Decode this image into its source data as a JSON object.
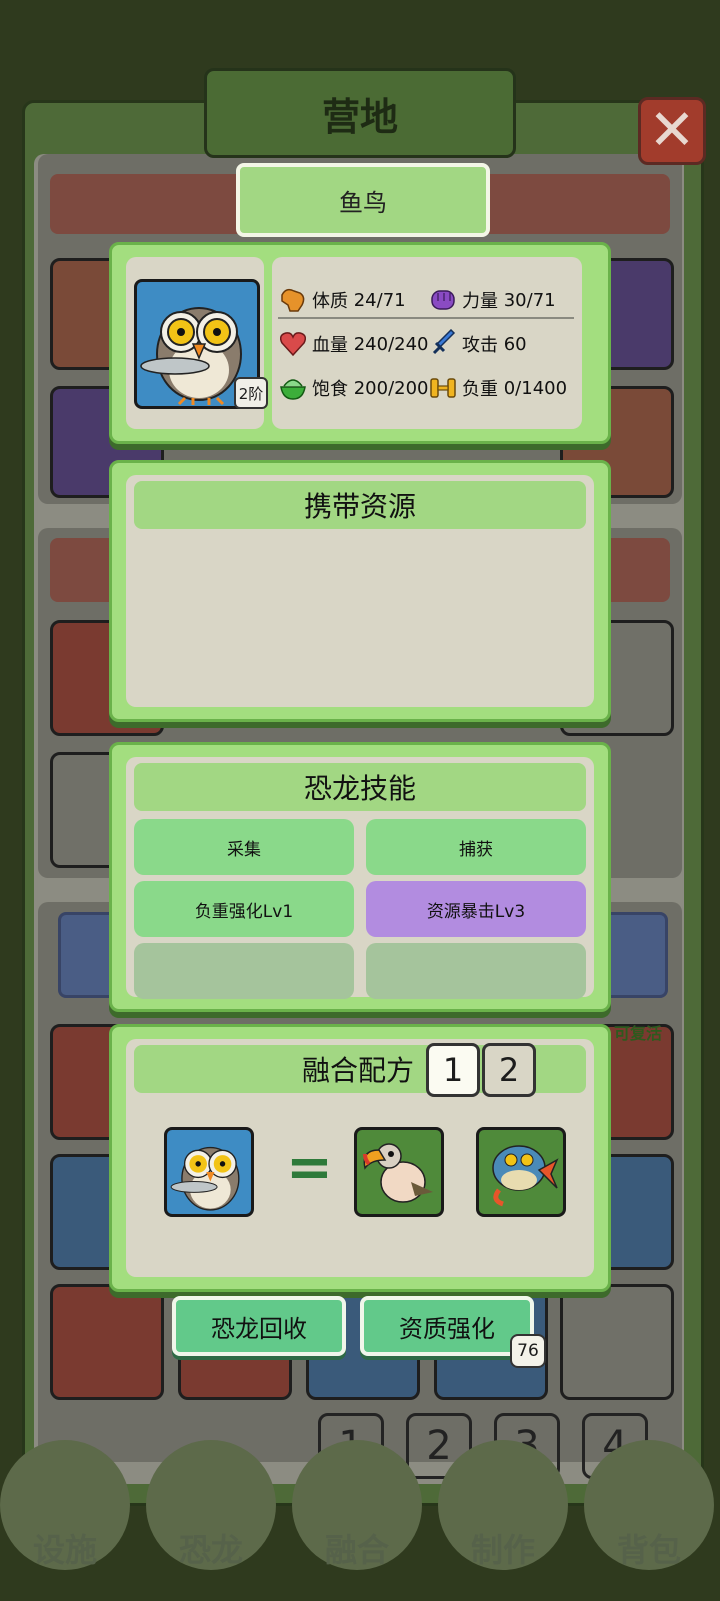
{
  "window": {
    "title": "营地",
    "close_symbol": "✕"
  },
  "dinosaur": {
    "name": "鱼鸟",
    "tier": "2阶"
  },
  "stats": [
    {
      "label": "体质",
      "value": "24/71",
      "icon": "muscle-arm-icon",
      "color": "#e6922a"
    },
    {
      "label": "力量",
      "value": "30/71",
      "icon": "fist-icon",
      "color": "#8a4bc3"
    },
    {
      "label": "血量",
      "value": "240/240",
      "icon": "heart-icon",
      "color": "#d94a4a"
    },
    {
      "label": "攻击",
      "value": "60",
      "icon": "sword-icon",
      "color": "#3a7ad6"
    },
    {
      "label": "饱食",
      "value": "200/200",
      "icon": "food-bowl-icon",
      "color": "#3cae3a"
    },
    {
      "label": "负重",
      "value": "0/1400",
      "icon": "dumbbell-icon",
      "color": "#f0b420"
    }
  ],
  "resources": {
    "title": "携带资源"
  },
  "skills": {
    "title": "恐龙技能",
    "items": [
      {
        "label": "采集",
        "color": "#8ad98a"
      },
      {
        "label": "捕获",
        "color": "#8ad98a"
      },
      {
        "label": "负重强化Lv1",
        "color": "#8ad98a"
      },
      {
        "label": "资源暴击Lv3",
        "color": "#b28ce0"
      },
      {
        "label": "",
        "color": "#a5c49c"
      },
      {
        "label": "",
        "color": "#a5c49c"
      }
    ]
  },
  "fusion": {
    "title": "融合配方",
    "tabs": [
      "1",
      "2"
    ],
    "equals": "="
  },
  "actions": {
    "recycle": "恐龙回收",
    "enhance": "资质强化",
    "enhance_badge": "76"
  },
  "bg": {
    "revive": "可复活"
  },
  "pages": [
    "1",
    "2",
    "3",
    "4"
  ],
  "nav": [
    "设施",
    "恐龙",
    "融合",
    "制作",
    "背包"
  ],
  "colors": {
    "accent": "#a3de7f",
    "frame": "#6ab24a",
    "button": "#62c98a"
  }
}
